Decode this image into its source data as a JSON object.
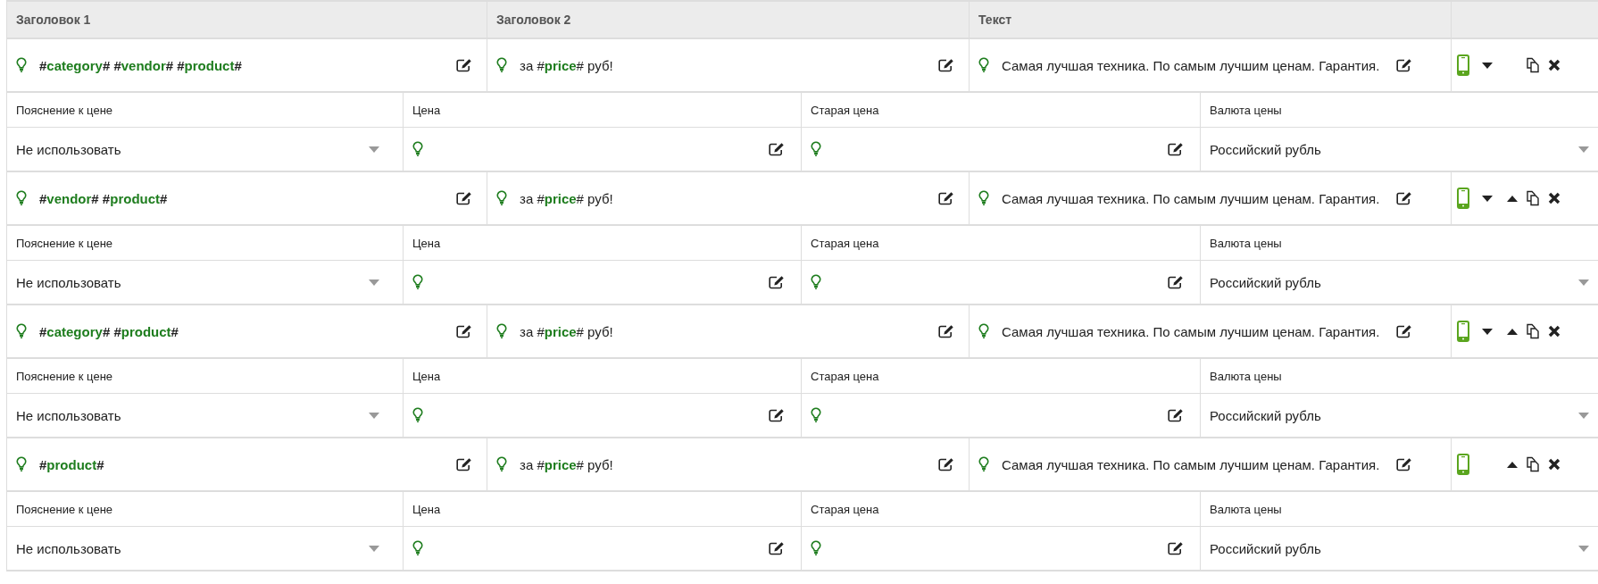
{
  "columns": [
    "Заголовок 1",
    "Заголовок 2",
    "Текст"
  ],
  "blocks": [
    {
      "title1": "#**category**# #**vendor**# #**product**#",
      "title2": "за #**price**# руб!",
      "text": "Самая лучшая техника. По самым лучшим ценам. Гарантия.",
      "can_move_up": false,
      "can_move_down": true,
      "fields": [
        {
          "kind": "select",
          "label": "Пояснение к цене",
          "value": "Не использовать"
        },
        {
          "kind": "template",
          "label": "Цена"
        },
        {
          "kind": "template",
          "label": "Старая цена"
        },
        {
          "kind": "select",
          "label": "Валюта цены",
          "value": "Российский рубль"
        }
      ]
    },
    {
      "title1": "#**vendor**# #**product**#",
      "title2": "за #**price**# руб!",
      "text": "Самая лучшая техника. По самым лучшим ценам. Гарантия.",
      "can_move_up": true,
      "can_move_down": true,
      "fields": [
        {
          "kind": "select",
          "label": "Пояснение к цене",
          "value": "Не использовать"
        },
        {
          "kind": "template",
          "label": "Цена"
        },
        {
          "kind": "template",
          "label": "Старая цена"
        },
        {
          "kind": "select",
          "label": "Валюта цены",
          "value": "Российский рубль"
        }
      ]
    },
    {
      "title1": "#**category**# #**product**#",
      "title2": "за #**price**# руб!",
      "text": "Самая лучшая техника. По самым лучшим ценам. Гарантия.",
      "can_move_up": true,
      "can_move_down": true,
      "fields": [
        {
          "kind": "select",
          "label": "Пояснение к цене",
          "value": "Не использовать"
        },
        {
          "kind": "template",
          "label": "Цена"
        },
        {
          "kind": "template",
          "label": "Старая цена"
        },
        {
          "kind": "select",
          "label": "Валюта цены",
          "value": "Российский рубль"
        }
      ]
    },
    {
      "title1": "#**product**#",
      "title2": "за #**price**# руб!",
      "text": "Самая лучшая техника. По самым лучшим ценам. Гарантия.",
      "can_move_up": true,
      "can_move_down": false,
      "fields": [
        {
          "kind": "select",
          "label": "Пояснение к цене",
          "value": "Не использовать"
        },
        {
          "kind": "template",
          "label": "Цена"
        },
        {
          "kind": "template",
          "label": "Старая цена"
        },
        {
          "kind": "select",
          "label": "Валюта цены",
          "value": "Российский рубль"
        }
      ]
    }
  ]
}
